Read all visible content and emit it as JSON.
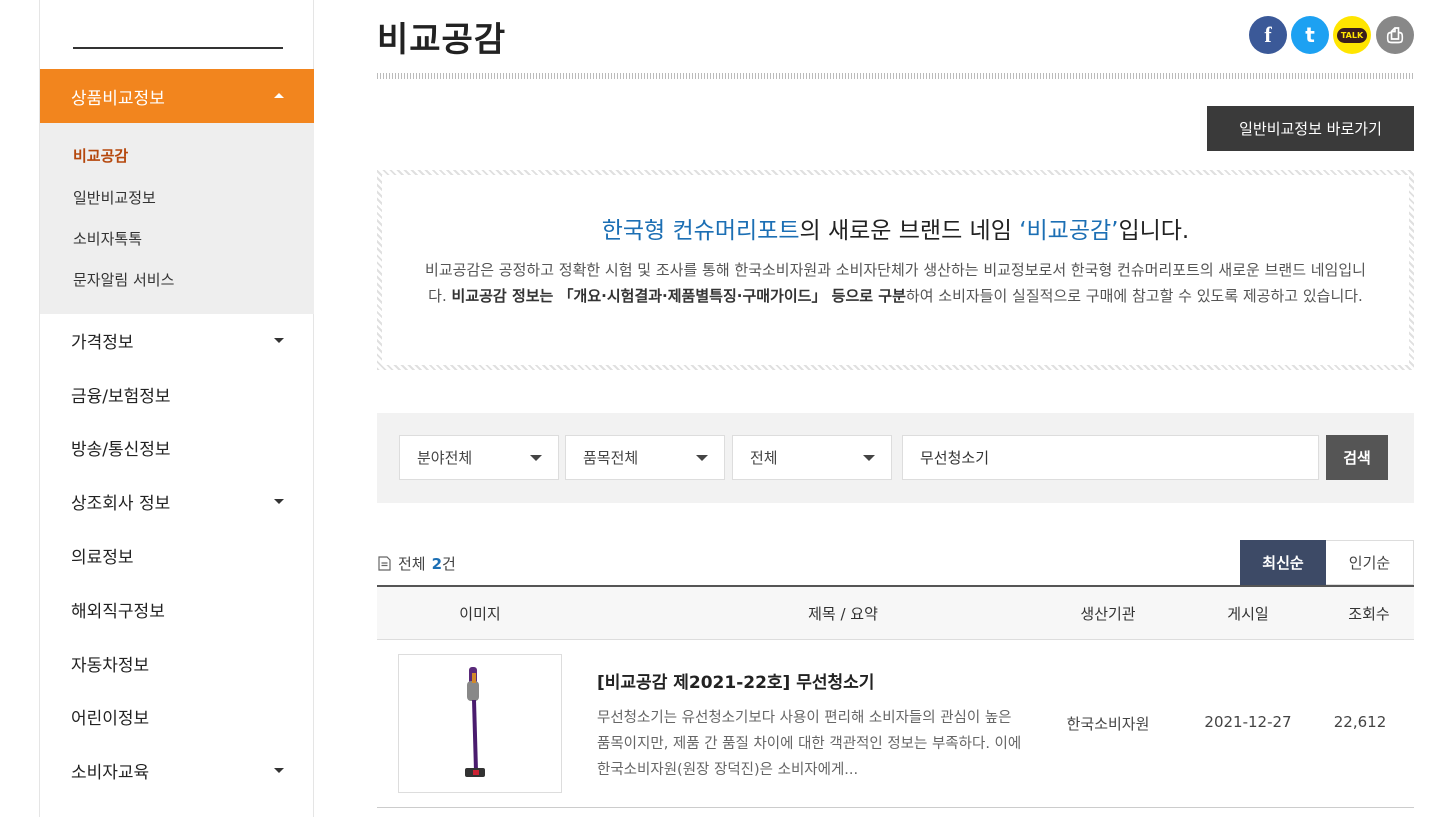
{
  "sidebar": {
    "active_menu": "상품비교정보",
    "submenu": [
      "비교공감",
      "일반비교정보",
      "소비자톡톡",
      "문자알림 서비스"
    ],
    "items": [
      {
        "label": "가격정보",
        "has_caret": true
      },
      {
        "label": "금융/보험정보",
        "has_caret": false
      },
      {
        "label": "방송/통신정보",
        "has_caret": false
      },
      {
        "label": "상조회사 정보",
        "has_caret": true
      },
      {
        "label": "의료정보",
        "has_caret": false
      },
      {
        "label": "해외직구정보",
        "has_caret": false
      },
      {
        "label": "자동차정보",
        "has_caret": false
      },
      {
        "label": "어린이정보",
        "has_caret": false
      },
      {
        "label": "소비자교육",
        "has_caret": true
      }
    ]
  },
  "header": {
    "title": "비교공감",
    "share": [
      {
        "name": "facebook-icon",
        "glyph": "f",
        "color": "#3b5998"
      },
      {
        "name": "twitter-icon",
        "glyph": "t",
        "color": "#1da1f2"
      },
      {
        "name": "kakaotalk-icon",
        "glyph": "TALK",
        "color": "#ffe500"
      },
      {
        "name": "print-icon",
        "glyph": "⎙",
        "color": "#888888"
      }
    ],
    "general_button": "일반비교정보 바로가기"
  },
  "intro": {
    "headline_pre": "한국형 컨슈머리포트",
    "headline_mid": "의 새로운 브랜드 네임 ",
    "headline_brand": "‘비교공감’",
    "headline_post": "입니다.",
    "body_1": "비교공감은 공정하고 정확한 시험 및 조사를 통해 한국소비자원과 소비자단체가 생산하는 비교정보로서 한국형 컨슈머리포트의 새로운 브랜드 네임입니다. ",
    "body_bold": "비교공감 정보는 「개요·시험결과·제품별특징·구매가이드」 등으로 구분",
    "body_2": "하여 소비자들이 실질적으로 구매에 참고할 수 있도록 제공하고 있습니다."
  },
  "search": {
    "field_select": "분야전체",
    "item_select": "품목전체",
    "scope_select": "전체",
    "query": "무선청소기",
    "button": "검색"
  },
  "list": {
    "total_label": "전체",
    "total_count": "2",
    "total_suffix": "건",
    "sort_latest": "최신순",
    "sort_popular": "인기순",
    "columns": [
      "이미지",
      "제목 / 요약",
      "생산기관",
      "게시일",
      "조회수"
    ],
    "rows": [
      {
        "title": "[비교공감 제2021-22호] 무선청소기",
        "summary": "무선청소기는 유선청소기보다 사용이 편리해 소비자들의 관심이 높은 품목이지만, 제품 간 품질 차이에 대한 객관적인 정보는 부족하다. 이에 한국소비자원(원장 장덕진)은 소비자에게...",
        "agency": "한국소비자원",
        "date": "2021-12-27",
        "views": "22,612"
      }
    ]
  },
  "colors": {
    "accent": "#f2851e",
    "link_blue": "#1c6fb4",
    "sort_active": "#3d4a66"
  }
}
